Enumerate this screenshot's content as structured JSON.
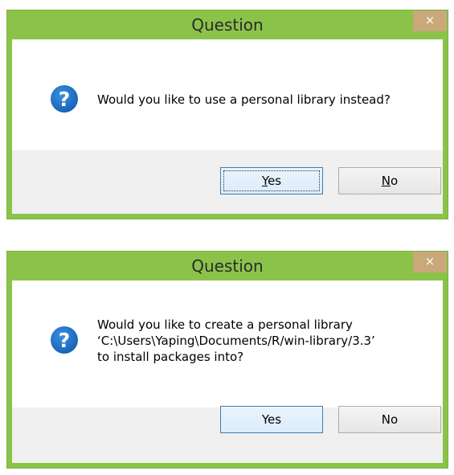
{
  "colors": {
    "frame": "#8bc34a",
    "close_button": "#c9a87a",
    "icon_blue": "#1f6fc5",
    "footer": "#f0f0f0"
  },
  "dialog1": {
    "title": "Question",
    "close_label": "×",
    "icon": "question-icon",
    "message_lines": [
      "Would you like to use a personal library instead?"
    ],
    "yes": {
      "accel": "Y",
      "rest": "es"
    },
    "no": {
      "accel": "N",
      "rest": "o"
    }
  },
  "dialog2": {
    "title": "Question",
    "close_label": "×",
    "icon": "question-icon",
    "message_lines": [
      "Would you like to create a personal library",
      "‘C:\\Users\\Yaping\\Documents/R/win-library/3.3’",
      "to install packages into?"
    ],
    "yes_label": "Yes",
    "no_label": "No"
  }
}
